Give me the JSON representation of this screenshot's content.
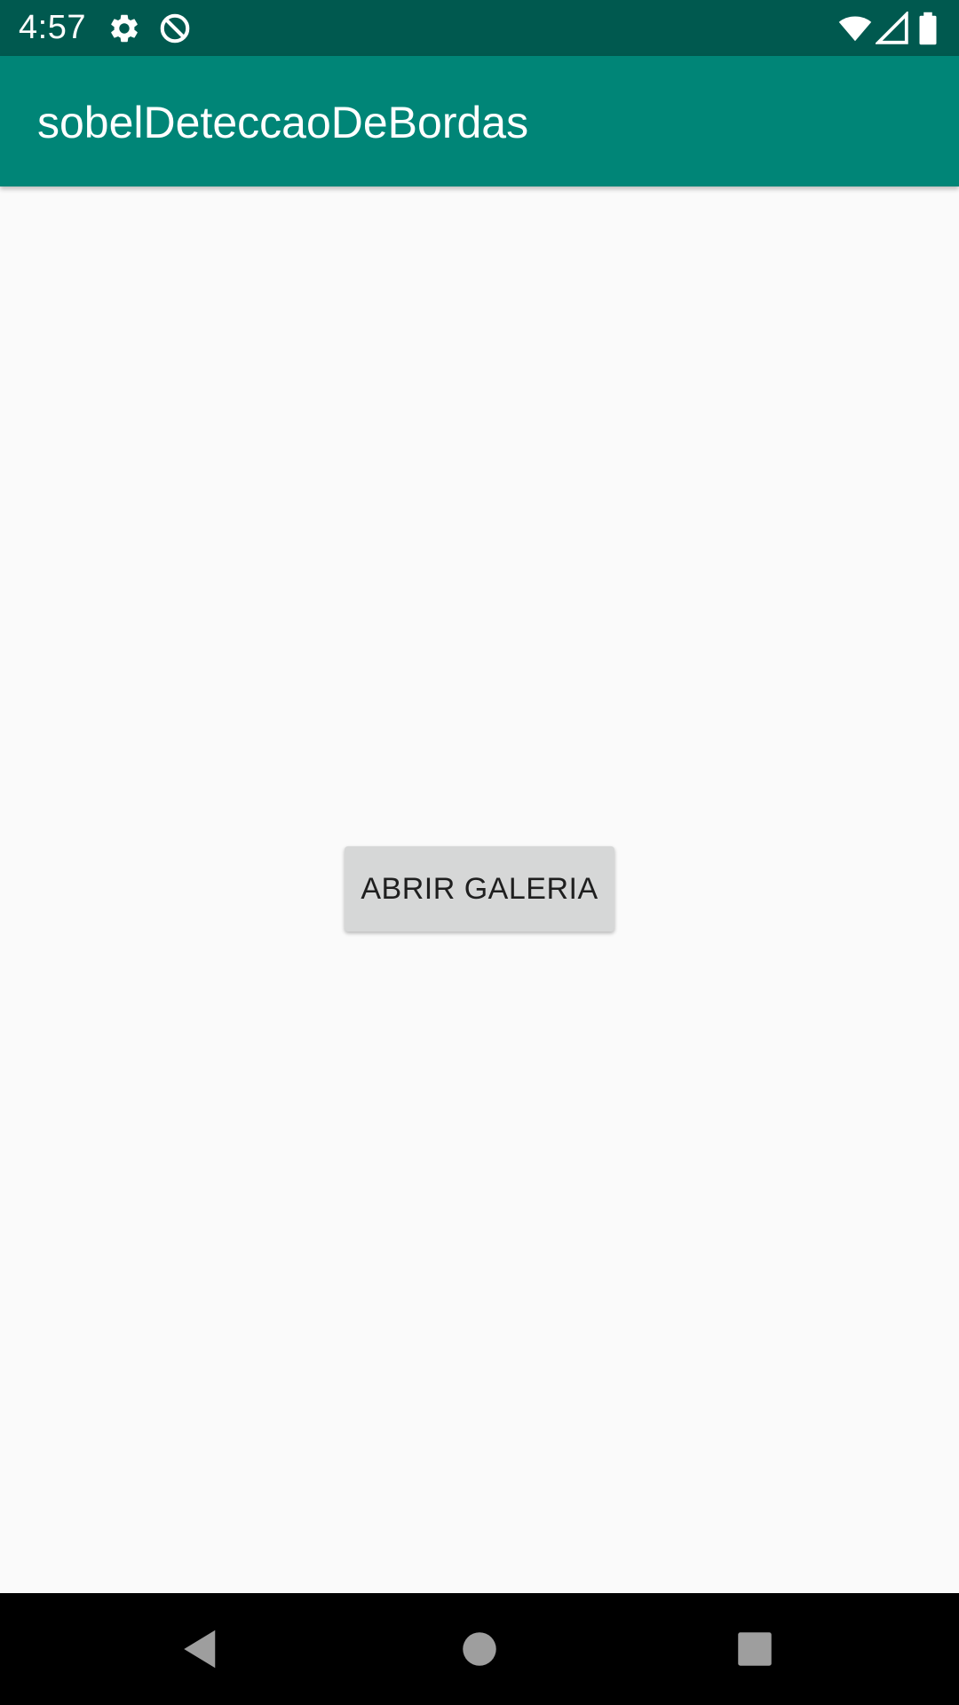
{
  "status_bar": {
    "time": "4:57",
    "icons": [
      "gear-icon",
      "data-saver-icon",
      "wifi-icon",
      "signal-icon",
      "battery-icon"
    ],
    "background": "#00594f"
  },
  "app_bar": {
    "title": "sobelDeteccaoDeBordas",
    "background": "#008577"
  },
  "main": {
    "button_label": "ABRIR GALERIA",
    "button_color": "#d6d7d7"
  },
  "nav_bar": {
    "buttons": [
      "back-icon",
      "home-icon",
      "recents-icon"
    ],
    "background": "#000000"
  }
}
